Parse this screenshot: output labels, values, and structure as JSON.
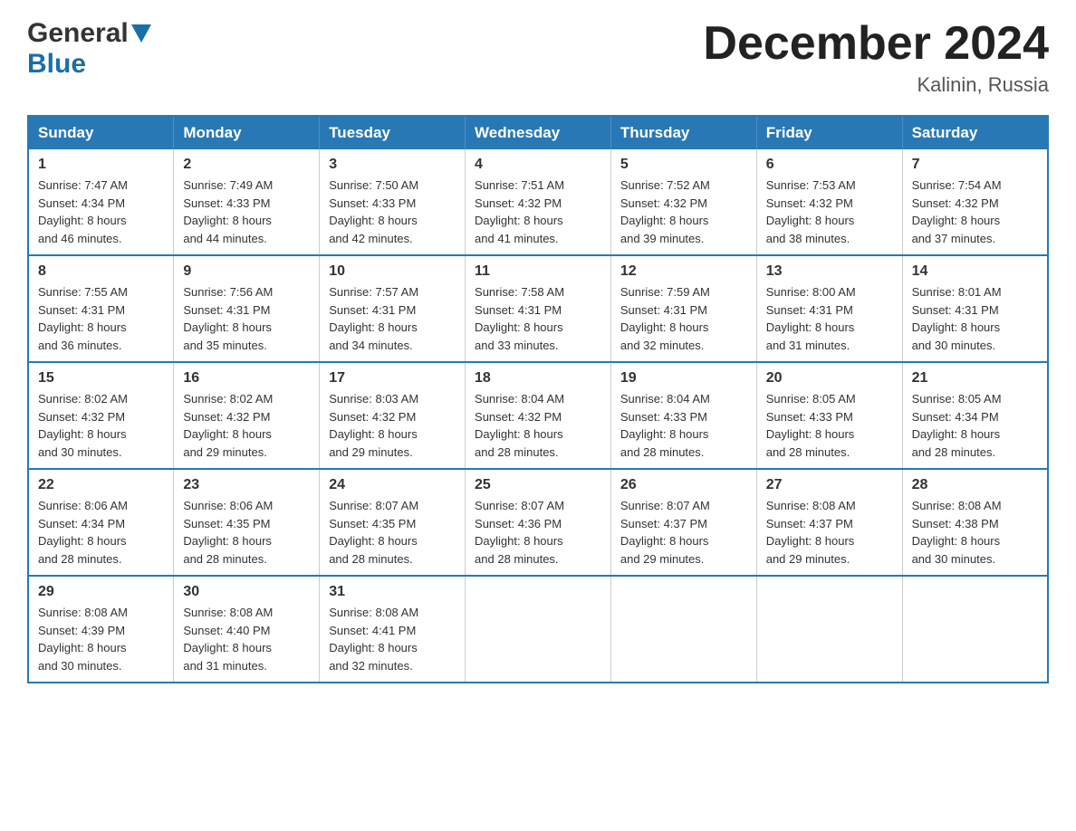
{
  "header": {
    "logo_general": "General",
    "logo_blue": "Blue",
    "title": "December 2024",
    "location": "Kalinin, Russia"
  },
  "days_of_week": [
    "Sunday",
    "Monday",
    "Tuesday",
    "Wednesday",
    "Thursday",
    "Friday",
    "Saturday"
  ],
  "weeks": [
    [
      {
        "day": "1",
        "sunrise": "7:47 AM",
        "sunset": "4:34 PM",
        "daylight": "8 hours and 46 minutes."
      },
      {
        "day": "2",
        "sunrise": "7:49 AM",
        "sunset": "4:33 PM",
        "daylight": "8 hours and 44 minutes."
      },
      {
        "day": "3",
        "sunrise": "7:50 AM",
        "sunset": "4:33 PM",
        "daylight": "8 hours and 42 minutes."
      },
      {
        "day": "4",
        "sunrise": "7:51 AM",
        "sunset": "4:32 PM",
        "daylight": "8 hours and 41 minutes."
      },
      {
        "day": "5",
        "sunrise": "7:52 AM",
        "sunset": "4:32 PM",
        "daylight": "8 hours and 39 minutes."
      },
      {
        "day": "6",
        "sunrise": "7:53 AM",
        "sunset": "4:32 PM",
        "daylight": "8 hours and 38 minutes."
      },
      {
        "day": "7",
        "sunrise": "7:54 AM",
        "sunset": "4:32 PM",
        "daylight": "8 hours and 37 minutes."
      }
    ],
    [
      {
        "day": "8",
        "sunrise": "7:55 AM",
        "sunset": "4:31 PM",
        "daylight": "8 hours and 36 minutes."
      },
      {
        "day": "9",
        "sunrise": "7:56 AM",
        "sunset": "4:31 PM",
        "daylight": "8 hours and 35 minutes."
      },
      {
        "day": "10",
        "sunrise": "7:57 AM",
        "sunset": "4:31 PM",
        "daylight": "8 hours and 34 minutes."
      },
      {
        "day": "11",
        "sunrise": "7:58 AM",
        "sunset": "4:31 PM",
        "daylight": "8 hours and 33 minutes."
      },
      {
        "day": "12",
        "sunrise": "7:59 AM",
        "sunset": "4:31 PM",
        "daylight": "8 hours and 32 minutes."
      },
      {
        "day": "13",
        "sunrise": "8:00 AM",
        "sunset": "4:31 PM",
        "daylight": "8 hours and 31 minutes."
      },
      {
        "day": "14",
        "sunrise": "8:01 AM",
        "sunset": "4:31 PM",
        "daylight": "8 hours and 30 minutes."
      }
    ],
    [
      {
        "day": "15",
        "sunrise": "8:02 AM",
        "sunset": "4:32 PM",
        "daylight": "8 hours and 30 minutes."
      },
      {
        "day": "16",
        "sunrise": "8:02 AM",
        "sunset": "4:32 PM",
        "daylight": "8 hours and 29 minutes."
      },
      {
        "day": "17",
        "sunrise": "8:03 AM",
        "sunset": "4:32 PM",
        "daylight": "8 hours and 29 minutes."
      },
      {
        "day": "18",
        "sunrise": "8:04 AM",
        "sunset": "4:32 PM",
        "daylight": "8 hours and 28 minutes."
      },
      {
        "day": "19",
        "sunrise": "8:04 AM",
        "sunset": "4:33 PM",
        "daylight": "8 hours and 28 minutes."
      },
      {
        "day": "20",
        "sunrise": "8:05 AM",
        "sunset": "4:33 PM",
        "daylight": "8 hours and 28 minutes."
      },
      {
        "day": "21",
        "sunrise": "8:05 AM",
        "sunset": "4:34 PM",
        "daylight": "8 hours and 28 minutes."
      }
    ],
    [
      {
        "day": "22",
        "sunrise": "8:06 AM",
        "sunset": "4:34 PM",
        "daylight": "8 hours and 28 minutes."
      },
      {
        "day": "23",
        "sunrise": "8:06 AM",
        "sunset": "4:35 PM",
        "daylight": "8 hours and 28 minutes."
      },
      {
        "day": "24",
        "sunrise": "8:07 AM",
        "sunset": "4:35 PM",
        "daylight": "8 hours and 28 minutes."
      },
      {
        "day": "25",
        "sunrise": "8:07 AM",
        "sunset": "4:36 PM",
        "daylight": "8 hours and 28 minutes."
      },
      {
        "day": "26",
        "sunrise": "8:07 AM",
        "sunset": "4:37 PM",
        "daylight": "8 hours and 29 minutes."
      },
      {
        "day": "27",
        "sunrise": "8:08 AM",
        "sunset": "4:37 PM",
        "daylight": "8 hours and 29 minutes."
      },
      {
        "day": "28",
        "sunrise": "8:08 AM",
        "sunset": "4:38 PM",
        "daylight": "8 hours and 30 minutes."
      }
    ],
    [
      {
        "day": "29",
        "sunrise": "8:08 AM",
        "sunset": "4:39 PM",
        "daylight": "8 hours and 30 minutes."
      },
      {
        "day": "30",
        "sunrise": "8:08 AM",
        "sunset": "4:40 PM",
        "daylight": "8 hours and 31 minutes."
      },
      {
        "day": "31",
        "sunrise": "8:08 AM",
        "sunset": "4:41 PM",
        "daylight": "8 hours and 32 minutes."
      },
      null,
      null,
      null,
      null
    ]
  ],
  "labels": {
    "sunrise": "Sunrise:",
    "sunset": "Sunset:",
    "daylight": "Daylight:"
  }
}
